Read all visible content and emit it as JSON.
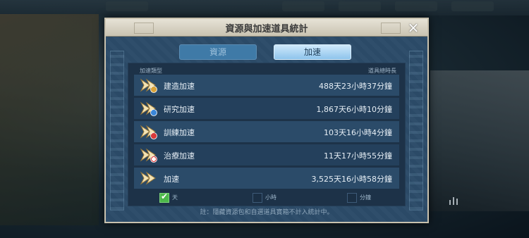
{
  "dialog": {
    "title": "資源與加速道具統計",
    "close_icon": "×"
  },
  "tabs": [
    {
      "label": "資源",
      "active": false
    },
    {
      "label": "加速",
      "active": true
    }
  ],
  "table": {
    "col_type": "加速類型",
    "col_time": "道具總時長",
    "rows": [
      {
        "name": "建造加速",
        "value": "488天23小時37分鐘",
        "icon": "build-speedup-icon",
        "badge_color": "#d9a33a"
      },
      {
        "name": "研究加速",
        "value": "1,867天6小時10分鐘",
        "icon": "research-speedup-icon",
        "badge_color": "#3a86d9"
      },
      {
        "name": "訓練加速",
        "value": "103天16小時4分鐘",
        "icon": "training-speedup-icon",
        "badge_color": "#d93a3a"
      },
      {
        "name": "治療加速",
        "value": "11天17小時55分鐘",
        "icon": "healing-speedup-icon",
        "badge_color": "#d93a3a"
      },
      {
        "name": "加速",
        "value": "3,525天16小時58分鐘",
        "icon": "universal-speedup-icon",
        "badge_color": "#d9a33a"
      }
    ]
  },
  "display_units": [
    {
      "label": "天",
      "checked": true
    },
    {
      "label": "小時",
      "checked": false
    },
    {
      "label": "分鐘",
      "checked": false
    }
  ],
  "footnote": "註：隱藏資源包和自選道具寶箱不計入統計中。",
  "colors": {
    "accent": "#8ec4ec",
    "check_green": "#4cb84a",
    "panel": "#1d3248"
  }
}
